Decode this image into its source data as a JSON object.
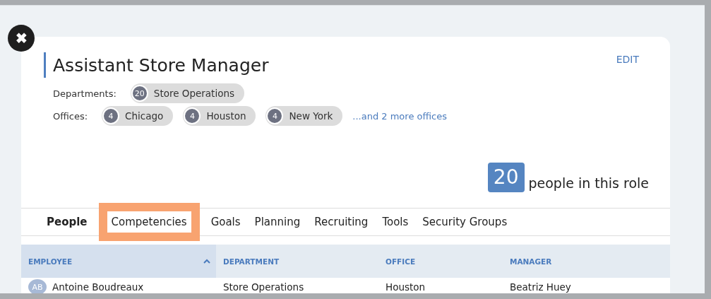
{
  "close_button": {
    "label": "✖"
  },
  "role": {
    "title": "Assistant Store Manager",
    "edit": "EDIT"
  },
  "departments": {
    "label": "Departments:",
    "items": [
      {
        "count": "20",
        "name": "Store Operations"
      }
    ]
  },
  "offices": {
    "label": "Offices:",
    "items": [
      {
        "count": "4",
        "name": "Chicago"
      },
      {
        "count": "4",
        "name": "Houston"
      },
      {
        "count": "4",
        "name": "New York"
      }
    ],
    "more": "...and 2 more offices"
  },
  "people_count": {
    "count": "20",
    "text": "people in this role"
  },
  "tabs": [
    {
      "label": "People",
      "selected": true,
      "highlighted": false
    },
    {
      "label": "Competencies",
      "selected": false,
      "highlighted": true
    },
    {
      "label": "Goals",
      "selected": false,
      "highlighted": false
    },
    {
      "label": "Planning",
      "selected": false,
      "highlighted": false
    },
    {
      "label": "Recruiting",
      "selected": false,
      "highlighted": false
    },
    {
      "label": "Tools",
      "selected": false,
      "highlighted": false
    },
    {
      "label": "Security Groups",
      "selected": false,
      "highlighted": false
    }
  ],
  "table": {
    "columns": [
      {
        "label": "EMPLOYEE",
        "sorted": true
      },
      {
        "label": "DEPARTMENT",
        "sorted": false
      },
      {
        "label": "OFFICE",
        "sorted": false
      },
      {
        "label": "MANAGER",
        "sorted": false
      }
    ],
    "rows": [
      {
        "initials": "AB",
        "employee": "Antoine Boudreaux",
        "department": "Store Operations",
        "office": "Houston",
        "manager": "Beatriz Huey"
      }
    ]
  }
}
